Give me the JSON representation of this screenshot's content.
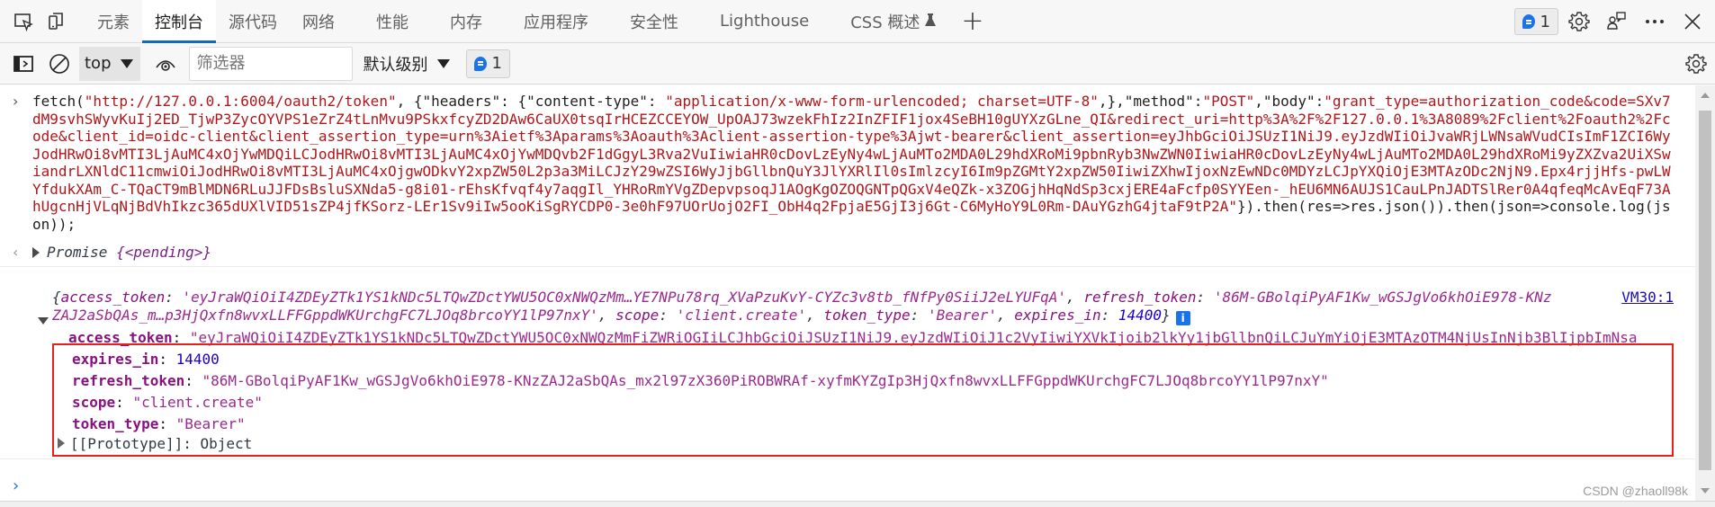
{
  "tabbar": {
    "tabs": [
      {
        "label": "元素",
        "active": false
      },
      {
        "label": "控制台",
        "active": true
      },
      {
        "label": "源代码",
        "active": false
      },
      {
        "label": "网络",
        "active": false
      },
      {
        "label": "性能",
        "active": false
      },
      {
        "label": "内存",
        "active": false
      },
      {
        "label": "应用程序",
        "active": false
      },
      {
        "label": "安全性",
        "active": false
      },
      {
        "label": "Lighthouse",
        "active": false
      },
      {
        "label": "CSS 概述",
        "active": false
      }
    ],
    "add_tab_label": "+",
    "issues_count": "1",
    "icons": [
      "inspect-element-icon",
      "device-emulation-icon",
      "flask-icon",
      "settings-icon",
      "feedback-icon",
      "more-icon",
      "close-icon"
    ]
  },
  "toolbar": {
    "context": "top",
    "filter_placeholder": "筛选器",
    "filter_value": "",
    "level": "默认级别",
    "issues_count": "1"
  },
  "console": {
    "input": {
      "prefix": "fetch(",
      "url": "\"http://127.0.0.1:6004/oauth2/token\"",
      "mid1": ", {\"headers\": {\"content-type\": ",
      "content_type": "\"application/x-www-form-urlencoded; charset=UTF-8\"",
      "mid2": ",},\"method\":",
      "method": "\"POST\"",
      "mid3": ",\"body\":",
      "body": "\"grant_type=authorization_code&code=SXv7dM9svhSWyvKuIj2ED_TjwP3ZycOYVPS1eZrZ4tLnMvu9PSkxfcyZD2DAw6CaUX0tsqIrHCEZCCEYOW_UpOAJ73wzekFhIz2InZFIF1jox4SeBH10gUYXzGLne_QI&redirect_uri=http%3A%2F%2F127.0.0.1%3A8089%2Fclient%2Foauth2%2Fcode&client_id=oidc-client&client_assertion_type=urn%3Aietf%3Aparams%3Aoauth%3Aclient-assertion-type%3Ajwt-bearer&client_assertion=eyJhbGciOiJSUzI1NiJ9.eyJzdWIiOiJvaWRjLWNsaWVudCIsImF1ZCI6WyJodHRwOi8vMTI3LjAuMC4xOjYwMDQiLCJodHRwOi8vMTI3LjAuMC4xOjYwMDQvb2F1dGgyL3Rva2VuIiwiaHR0cDovLzEyNy4wLjAuMTo2MDA0L29hdXRoMi9pbnRyb3NwZWN0IiwiaHR0cDovLzEyNy4wLjAuMTo2MDA0L29hdXRoMi9yZXZva2UiXSwiandrLXNldC11cmwiOiJodHRwOi8vMTI3LjAuMC4xOjgwODkvY2xpZW50L2p3a3MiLCJzY29wZSI6WyJjbGllbnQuY3JlYXRlIl0sImlzcyI6Im9pZGMtY2xpZW50IiwiZXhwIjoxNzEwNDc0MDYzLCJpYXQiOjE3MTAzODc2NjN9.Epx4rjjHfs-pwLWYfdukXAm_C-TQaCT9mBlMDN6RLuJJFDsBsluSXNda5-g8i01-rEhsKfvqf4y7aqgIl_YHRoRmYVgZDepvpsoqJ1AOgKgOZOQGNTpQGxV4eQZk-x3ZOGjhHqNdSp3cxjERE4aFcfp0SYYEen-_hEU6MN6AUJS1CauLPnJADTSlRer0A4qfeqMcAvEqF73AhUgcnHjVLqNjBdVhIkzc365dUXlVID51sZP4jfKSorz-LEr1Sv9iIw5ooKiSgRYCDP0-3e0hF97UOrUojO2FI_ObH4q2FpjaE5GjI3j6Gt-C6MyHoY9L0Rm-DAuYGzhG4jtaF9tP2A\"",
      "suffix": "}).then(res=>res.json()).then(json=>console.log(json));"
    },
    "result": {
      "prefix": "Promise ",
      "value": "{<pending>}"
    },
    "log": {
      "source_link": "VM30:1",
      "preview": [
        {
          "key": "access_token",
          "value": "'eyJraWQiOiI4ZDEyZTk1YS1kNDc5LTQwZDctYWU5OC0xNWQzMm…YE7NPu78rq_XVaPzuKvY-CYZc3v8tb_fNfPy0SiiJ2eLYUFqA'",
          "type": "string"
        },
        {
          "key": "refresh_token",
          "value": "'86M-GBolqiPyAF1Kw_wGSJgVo6khOiE978-KNzZAJ2aSbQAs_m…p3HjQxfn8wvxLLFFGppdWKUrchgFC7LJOq8brcoYY1lP97nxY'",
          "type": "string"
        },
        {
          "key": "scope",
          "value": "'client.create'",
          "type": "string"
        },
        {
          "key": "token_type",
          "value": "'Bearer'",
          "type": "string"
        },
        {
          "key": "expires_in",
          "value": "14400",
          "type": "number"
        }
      ],
      "properties": [
        {
          "key": "access_token",
          "value": "\"eyJraWQiOiI4ZDEyZTk1YS1kNDc5LTQwZDctYWU5OC0xNWQzMmFiZWRiOGIiLCJhbGciOiJSUzI1NiJ9.eyJzdWIiOiJ1c2VyIiwiYXVkIjoib2lkYy1jbGllbnQiLCJuYmYiOjE3MTAzOTM4NjUsInNjb3BlIjpbImNsa",
          "type": "string"
        },
        {
          "key": "expires_in",
          "value": "14400",
          "type": "number"
        },
        {
          "key": "refresh_token",
          "value": "\"86M-GBolqiPyAF1Kw_wGSJgVo6khOiE978-KNzZAJ2aSbQAs_mx2l97zX360PiROBWRAf-xyfmKYZgIp3HjQxfn8wvxLLFFGppdWKUrchgFC7LJOq8brcoYY1lP97nxY\"",
          "type": "string"
        },
        {
          "key": "scope",
          "value": "\"client.create\"",
          "type": "string"
        },
        {
          "key": "token_type",
          "value": "\"Bearer\"",
          "type": "string"
        }
      ],
      "prototype_label": "[[Prototype]]: Object"
    },
    "prompt_glyph": "›"
  },
  "watermark": "CSDN @zhaoll98k",
  "colors": {
    "accent": "#0f6cbd",
    "string": "#b0171b",
    "prop_key": "#881280",
    "number": "#1c00cf",
    "highlight_border": "#e8201c"
  }
}
